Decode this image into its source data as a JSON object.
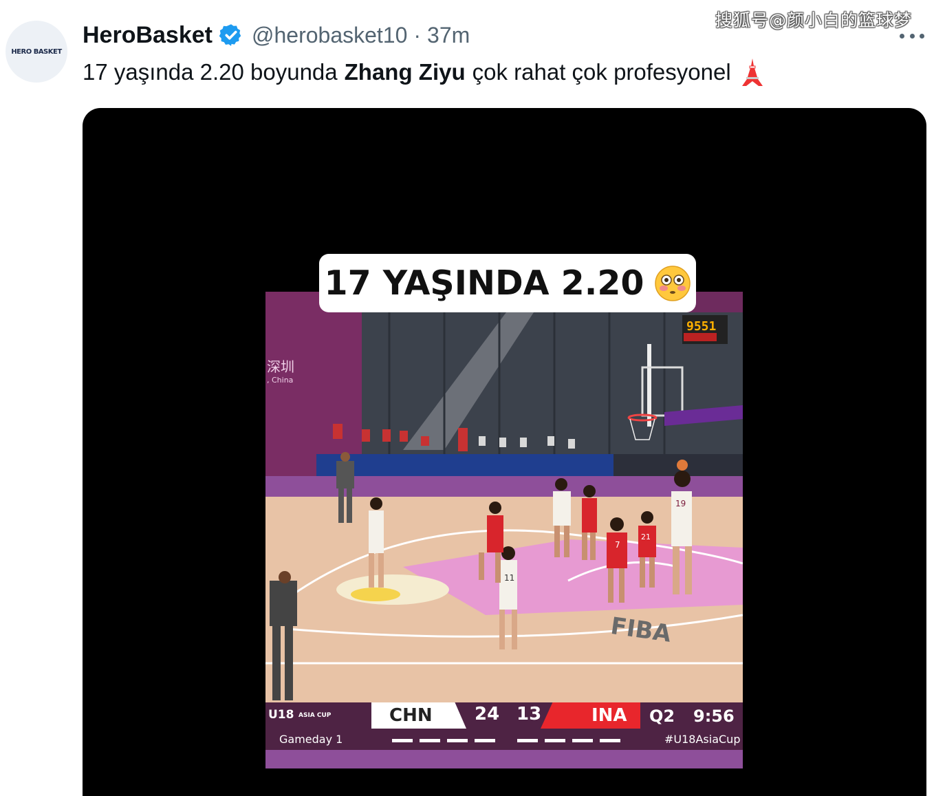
{
  "watermark": "搜狐号@颜小白的篮球梦",
  "tweet": {
    "avatar_text": "HERO BASKET",
    "display_name": "HeroBasket",
    "handle": "@herobasket10",
    "separator": "·",
    "time": "37m",
    "text_before": "17 yaşında 2.20 boyunda",
    "text_bold": "Zhang Ziyu",
    "text_after": "çok rahat çok profesyonel",
    "emoji_icon": "tokyo-tower-icon"
  },
  "video": {
    "caption": "17 YAŞINDA 2.20",
    "caption_emoji": "flushed-face-icon",
    "venue_text": "深圳",
    "venue_sub": ", China",
    "shot_clock": "9551",
    "court_text": "FIBA",
    "scoreboard": {
      "brand": "U18",
      "brand_sub": "ASIA CUP",
      "team_home": "CHN",
      "score_home": "24",
      "score_away": "13",
      "team_away": "INA",
      "quarter": "Q2",
      "clock": "9:56",
      "gameday": "Gameday 1",
      "hashtag": "#U18AsiaCup"
    },
    "jersey_numbers": [
      "19",
      "11",
      "7",
      "21"
    ]
  },
  "colors": {
    "verified": "#1d9bf0",
    "secondary_text": "#536471",
    "court": "#e8c3a6",
    "paint": "#e79ad2",
    "score_bar": "#4e2344",
    "away_team": "#e8262c"
  }
}
